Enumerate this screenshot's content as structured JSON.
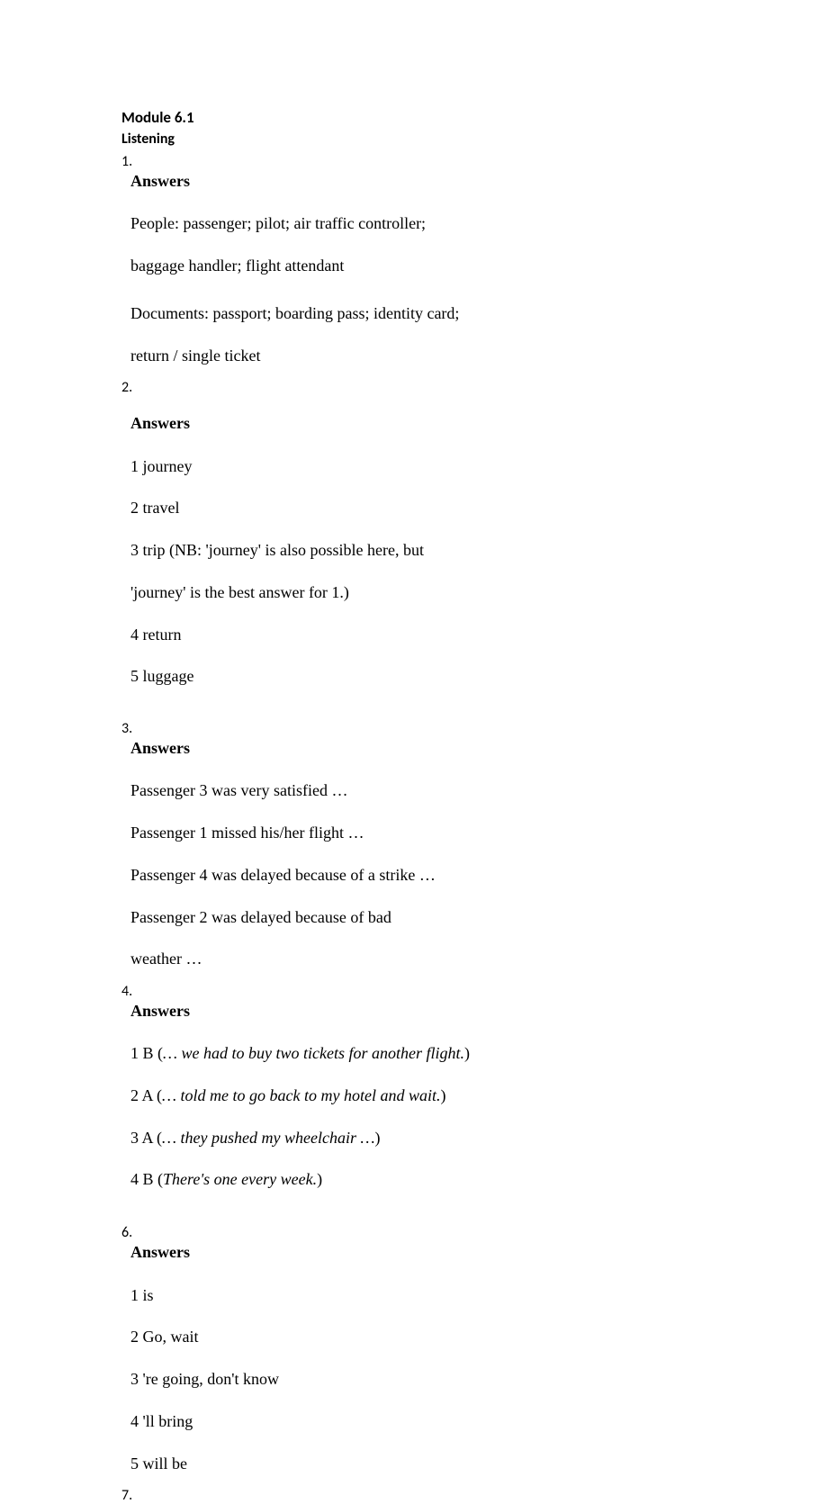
{
  "module_title": "Module 6.1",
  "section_label": "Listening",
  "q1": {
    "num": "1.",
    "heading": "Answers",
    "line1": "People: passenger; pilot; air traffic controller;",
    "line2": "baggage handler; flight attendant",
    "line3": "Documents: passport; boarding pass; identity card;",
    "line4": "return / single ticket"
  },
  "q2": {
    "num": "2.",
    "heading": "Answers",
    "items": [
      "1  journey",
      "2  travel",
      "3  trip (NB: 'journey' is also possible here, but",
      "'journey' is the best answer for 1.)",
      "4  return",
      "5  luggage"
    ]
  },
  "q3": {
    "num": "3.",
    "heading": "Answers",
    "lines": [
      "Passenger 3 was very satisfied …",
      "Passenger 1 missed his/her flight …",
      "Passenger 4 was delayed because of a strike …",
      "Passenger 2 was delayed because of bad",
      "weather …"
    ]
  },
  "q4": {
    "num": "4.",
    "heading": "Answers",
    "items": [
      {
        "prefix": "1  B (",
        "italic": "… we had to buy two tickets for another flight.",
        "suffix": ")"
      },
      {
        "prefix": "2  A (",
        "italic": "… told me to go back to my hotel and wait.",
        "suffix": ")"
      },
      {
        "prefix": "3  A (",
        "italic": "… they pushed my wheelchair …",
        "suffix": ")"
      },
      {
        "prefix": "4  B (",
        "italic": "There's one every week.",
        "suffix": ")"
      }
    ]
  },
  "q6": {
    "num": "6.",
    "heading": "Answers",
    "items": [
      "1  is",
      "2  Go, wait",
      "3  're going, don't know",
      "4  'll bring",
      "5  will be"
    ]
  },
  "q7": {
    "num": "7."
  }
}
